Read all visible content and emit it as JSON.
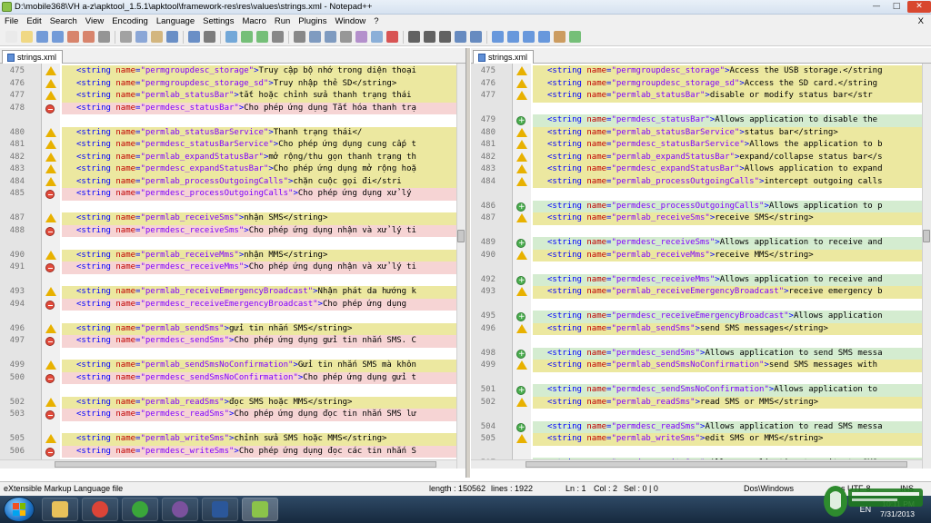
{
  "window": {
    "title": "D:\\mobile368\\VH a-z\\apktool_1.5.1\\apktool\\framework-res\\res\\values\\strings.xml - Notepad++",
    "controls": [
      "minimize",
      "maximize",
      "close"
    ]
  },
  "menubar": {
    "items": [
      "File",
      "Edit",
      "Search",
      "View",
      "Encoding",
      "Language",
      "Settings",
      "Macro",
      "Run",
      "Plugins",
      "Window",
      "?"
    ],
    "close_label": "X"
  },
  "toolbar": {
    "icons": [
      "new-file-icon",
      "open-file-icon",
      "save-icon",
      "save-all-icon",
      "close-icon",
      "close-all-icon",
      "print-icon",
      "cut-icon",
      "copy-icon",
      "paste-icon",
      "undo-icon",
      "redo-icon",
      "find-icon",
      "replace-icon",
      "zoom-in-icon",
      "zoom-out-icon",
      "sync-vertical-icon",
      "sync-horizontal-icon",
      "word-wrap-icon",
      "show-all-chars-icon",
      "indent-guide-icon",
      "user-defined-language-icon",
      "doc-map-icon",
      "record-macro-icon",
      "stop-record-icon",
      "play-macro-icon",
      "run-macro-multiple-icon",
      "save-macro-icon",
      "compare-icon",
      "prev-diff-icon",
      "next-diff-icon",
      "first-diff-icon",
      "last-diff-icon",
      "clear-compare-icon",
      "spell-check-icon"
    ]
  },
  "colors": {
    "changed": "#ece8a0",
    "removed": "#f6d4d4",
    "added": "#d4ecd0",
    "tag": "#0000ff",
    "attribute": "#c00000",
    "value": "#8000ff"
  },
  "left_pane": {
    "tab_label": "strings.xml",
    "lines": [
      {
        "n": "475",
        "mark": "warn",
        "type": "changed",
        "name": "permgroupdesc_storage",
        "text": "Truy cập bộ nhớ trong diện thoại"
      },
      {
        "n": "476",
        "mark": "warn",
        "type": "changed",
        "name": "permgroupdesc_storage_sd",
        "text": "Truy nhập thẻ SD</string>"
      },
      {
        "n": "477",
        "mark": "warn",
        "type": "changed",
        "name": "permlab_statusBar",
        "text": "tắt hoặc chỉnh sửa thanh trạng thái"
      },
      {
        "n": "478",
        "mark": "del",
        "type": "removed",
        "name": "permdesc_statusBar",
        "text": "Cho phép ứng dụng Tắt hóa thanh trạ"
      },
      {
        "n": "",
        "mark": "",
        "type": "blank",
        "name": "",
        "text": ""
      },
      {
        "n": "480",
        "mark": "warn",
        "type": "changed",
        "name": "permlab_statusBarService",
        "text": "Thanh trạng thái</"
      },
      {
        "n": "481",
        "mark": "warn",
        "type": "changed",
        "name": "permdesc_statusBarService",
        "text": "Cho phép ứng dụng cung cấp t"
      },
      {
        "n": "482",
        "mark": "warn",
        "type": "changed",
        "name": "permlab_expandStatusBar",
        "text": "mở rộng/thu gọn thanh trạng th"
      },
      {
        "n": "483",
        "mark": "warn",
        "type": "changed",
        "name": "permdesc_expandStatusBar",
        "text": "Cho phép ứng dụng mở rộng hoặ"
      },
      {
        "n": "484",
        "mark": "warn",
        "type": "changed",
        "name": "permlab_processOutgoingCalls",
        "text": "chặn cuộc gọi đi</stri"
      },
      {
        "n": "485",
        "mark": "del",
        "type": "removed",
        "name": "permdesc_processOutgoingCalls",
        "text": "Cho phép ứng dụng xử lý"
      },
      {
        "n": "",
        "mark": "",
        "type": "blank",
        "name": "",
        "text": ""
      },
      {
        "n": "487",
        "mark": "warn",
        "type": "changed",
        "name": "permlab_receiveSms",
        "text": "nhận SMS</string>"
      },
      {
        "n": "488",
        "mark": "del",
        "type": "removed",
        "name": "permdesc_receiveSms",
        "text": "Cho phép ứng dụng nhận và xử lý ti"
      },
      {
        "n": "",
        "mark": "",
        "type": "blank",
        "name": "",
        "text": ""
      },
      {
        "n": "490",
        "mark": "warn",
        "type": "changed",
        "name": "permlab_receiveMms",
        "text": "nhận MMS</string>"
      },
      {
        "n": "491",
        "mark": "del",
        "type": "removed",
        "name": "permdesc_receiveMms",
        "text": "Cho phép ứng dụng nhận và xử lý ti"
      },
      {
        "n": "",
        "mark": "",
        "type": "blank",
        "name": "",
        "text": ""
      },
      {
        "n": "493",
        "mark": "warn",
        "type": "changed",
        "name": "permlab_receiveEmergencyBroadcast",
        "text": "Nhận phát da hướng k"
      },
      {
        "n": "494",
        "mark": "del",
        "type": "removed",
        "name": "permdesc_receiveEmergencyBroadcast",
        "text": "Cho phép ứng dụng"
      },
      {
        "n": "",
        "mark": "",
        "type": "blank",
        "name": "",
        "text": ""
      },
      {
        "n": "496",
        "mark": "warn",
        "type": "changed",
        "name": "permlab_sendSms",
        "text": "gửi tin nhắn SMS</string>"
      },
      {
        "n": "497",
        "mark": "del",
        "type": "removed",
        "name": "permdesc_sendSms",
        "text": "Cho phép ứng dụng gửi tin nhắn SMS. C"
      },
      {
        "n": "",
        "mark": "",
        "type": "blank",
        "name": "",
        "text": ""
      },
      {
        "n": "499",
        "mark": "warn",
        "type": "changed",
        "name": "permlab_sendSmsNoConfirmation",
        "text": "Gửi tin nhắn SMS mà khôn"
      },
      {
        "n": "500",
        "mark": "del",
        "type": "removed",
        "name": "permdesc_sendSmsNoConfirmation",
        "text": "Cho phép ứng dụng gửi t"
      },
      {
        "n": "",
        "mark": "",
        "type": "blank",
        "name": "",
        "text": ""
      },
      {
        "n": "502",
        "mark": "warn",
        "type": "changed",
        "name": "permlab_readSms",
        "text": "đọc SMS hoặc MMS</string>"
      },
      {
        "n": "503",
        "mark": "del",
        "type": "removed",
        "name": "permdesc_readSms",
        "text": "Cho phép ứng dụng đọc tin nhắn SMS lư"
      },
      {
        "n": "",
        "mark": "",
        "type": "blank",
        "name": "",
        "text": ""
      },
      {
        "n": "505",
        "mark": "warn",
        "type": "changed",
        "name": "permlab_writeSms",
        "text": "chỉnh sửa SMS hoặc MMS</string>"
      },
      {
        "n": "506",
        "mark": "del",
        "type": "removed",
        "name": "permdesc_writeSms",
        "text": "Cho phép ứng dụng đọc các tin nhắn S"
      }
    ]
  },
  "right_pane": {
    "tab_label": "strings.xml",
    "lines": [
      {
        "n": "475",
        "mark": "warn",
        "type": "changed",
        "name": "permgroupdesc_storage",
        "text": "Access the USB storage.</string"
      },
      {
        "n": "476",
        "mark": "warn",
        "type": "changed",
        "name": "permgroupdesc_storage_sd",
        "text": "Access the SD card.</string"
      },
      {
        "n": "477",
        "mark": "warn",
        "type": "changed",
        "name": "permlab_statusBar",
        "text": "disable or modify status bar</str"
      },
      {
        "n": "",
        "mark": "",
        "type": "blank",
        "name": "",
        "text": ""
      },
      {
        "n": "479",
        "mark": "add",
        "type": "added",
        "name": "permdesc_statusBar",
        "text": "Allows application to disable the"
      },
      {
        "n": "480",
        "mark": "warn",
        "type": "changed",
        "name": "permlab_statusBarService",
        "text": "status bar</string>"
      },
      {
        "n": "481",
        "mark": "warn",
        "type": "changed",
        "name": "permdesc_statusBarService",
        "text": "Allows the application to b"
      },
      {
        "n": "482",
        "mark": "warn",
        "type": "changed",
        "name": "permlab_expandStatusBar",
        "text": "expand/collapse status bar</s"
      },
      {
        "n": "483",
        "mark": "warn",
        "type": "changed",
        "name": "permdesc_expandStatusBar",
        "text": "Allows application to expand"
      },
      {
        "n": "484",
        "mark": "warn",
        "type": "changed",
        "name": "permlab_processOutgoingCalls",
        "text": "intercept outgoing calls"
      },
      {
        "n": "",
        "mark": "",
        "type": "blank",
        "name": "",
        "text": ""
      },
      {
        "n": "486",
        "mark": "add",
        "type": "added",
        "name": "permdesc_processOutgoingCalls",
        "text": "Allows application to p"
      },
      {
        "n": "487",
        "mark": "warn",
        "type": "changed",
        "name": "permlab_receiveSms",
        "text": "receive SMS</string>"
      },
      {
        "n": "",
        "mark": "",
        "type": "blank",
        "name": "",
        "text": ""
      },
      {
        "n": "489",
        "mark": "add",
        "type": "added",
        "name": "permdesc_receiveSms",
        "text": "Allows application to receive and"
      },
      {
        "n": "490",
        "mark": "warn",
        "type": "changed",
        "name": "permlab_receiveMms",
        "text": "receive MMS</string>"
      },
      {
        "n": "",
        "mark": "",
        "type": "blank",
        "name": "",
        "text": ""
      },
      {
        "n": "492",
        "mark": "add",
        "type": "added",
        "name": "permdesc_receiveMms",
        "text": "Allows application to receive and"
      },
      {
        "n": "493",
        "mark": "warn",
        "type": "changed",
        "name": "permlab_receiveEmergencyBroadcast",
        "text": "receive emergency b"
      },
      {
        "n": "",
        "mark": "",
        "type": "blank",
        "name": "",
        "text": ""
      },
      {
        "n": "495",
        "mark": "add",
        "type": "added",
        "name": "permdesc_receiveEmergencyBroadcast",
        "text": "Allows application"
      },
      {
        "n": "496",
        "mark": "warn",
        "type": "changed",
        "name": "permlab_sendSms",
        "text": "send SMS messages</string>"
      },
      {
        "n": "",
        "mark": "",
        "type": "blank",
        "name": "",
        "text": ""
      },
      {
        "n": "498",
        "mark": "add",
        "type": "added",
        "name": "permdesc_sendSms",
        "text": "Allows application to send SMS messa"
      },
      {
        "n": "499",
        "mark": "warn",
        "type": "changed",
        "name": "permlab_sendSmsNoConfirmation",
        "text": "send SMS messages with"
      },
      {
        "n": "",
        "mark": "",
        "type": "blank",
        "name": "",
        "text": ""
      },
      {
        "n": "501",
        "mark": "add",
        "type": "added",
        "name": "permdesc_sendSmsNoConfirmation",
        "text": "Allows application to"
      },
      {
        "n": "502",
        "mark": "warn",
        "type": "changed",
        "name": "permlab_readSms",
        "text": "read SMS or MMS</string>"
      },
      {
        "n": "",
        "mark": "",
        "type": "blank",
        "name": "",
        "text": ""
      },
      {
        "n": "504",
        "mark": "add",
        "type": "added",
        "name": "permdesc_readSms",
        "text": "Allows application to read SMS messa"
      },
      {
        "n": "505",
        "mark": "warn",
        "type": "changed",
        "name": "permlab_writeSms",
        "text": "edit SMS or MMS</string>"
      },
      {
        "n": "",
        "mark": "",
        "type": "blank",
        "name": "",
        "text": ""
      },
      {
        "n": "507",
        "mark": "add",
        "type": "added",
        "name": "permdesc_writeSms",
        "text": "Allows application to write to SMS"
      }
    ]
  },
  "statusbar": {
    "file_type": "eXtensible Markup Language file",
    "length": "length : 150562",
    "lines": "lines : 1922",
    "ln": "Ln : 1",
    "col": "Col : 2",
    "sel": "Sel : 0 | 0",
    "eol": "Dos\\Windows",
    "encoding": "as UTF-8",
    "mode": "INS"
  },
  "taskbar": {
    "apps": [
      "explorer-icon",
      "chrome-icon",
      "coccoc-icon",
      "viber-icon",
      "word-icon",
      "notepadpp-icon"
    ],
    "active_index": 5,
    "lang": "EN",
    "time": "10:11 PM",
    "date": "7/31/2013"
  }
}
